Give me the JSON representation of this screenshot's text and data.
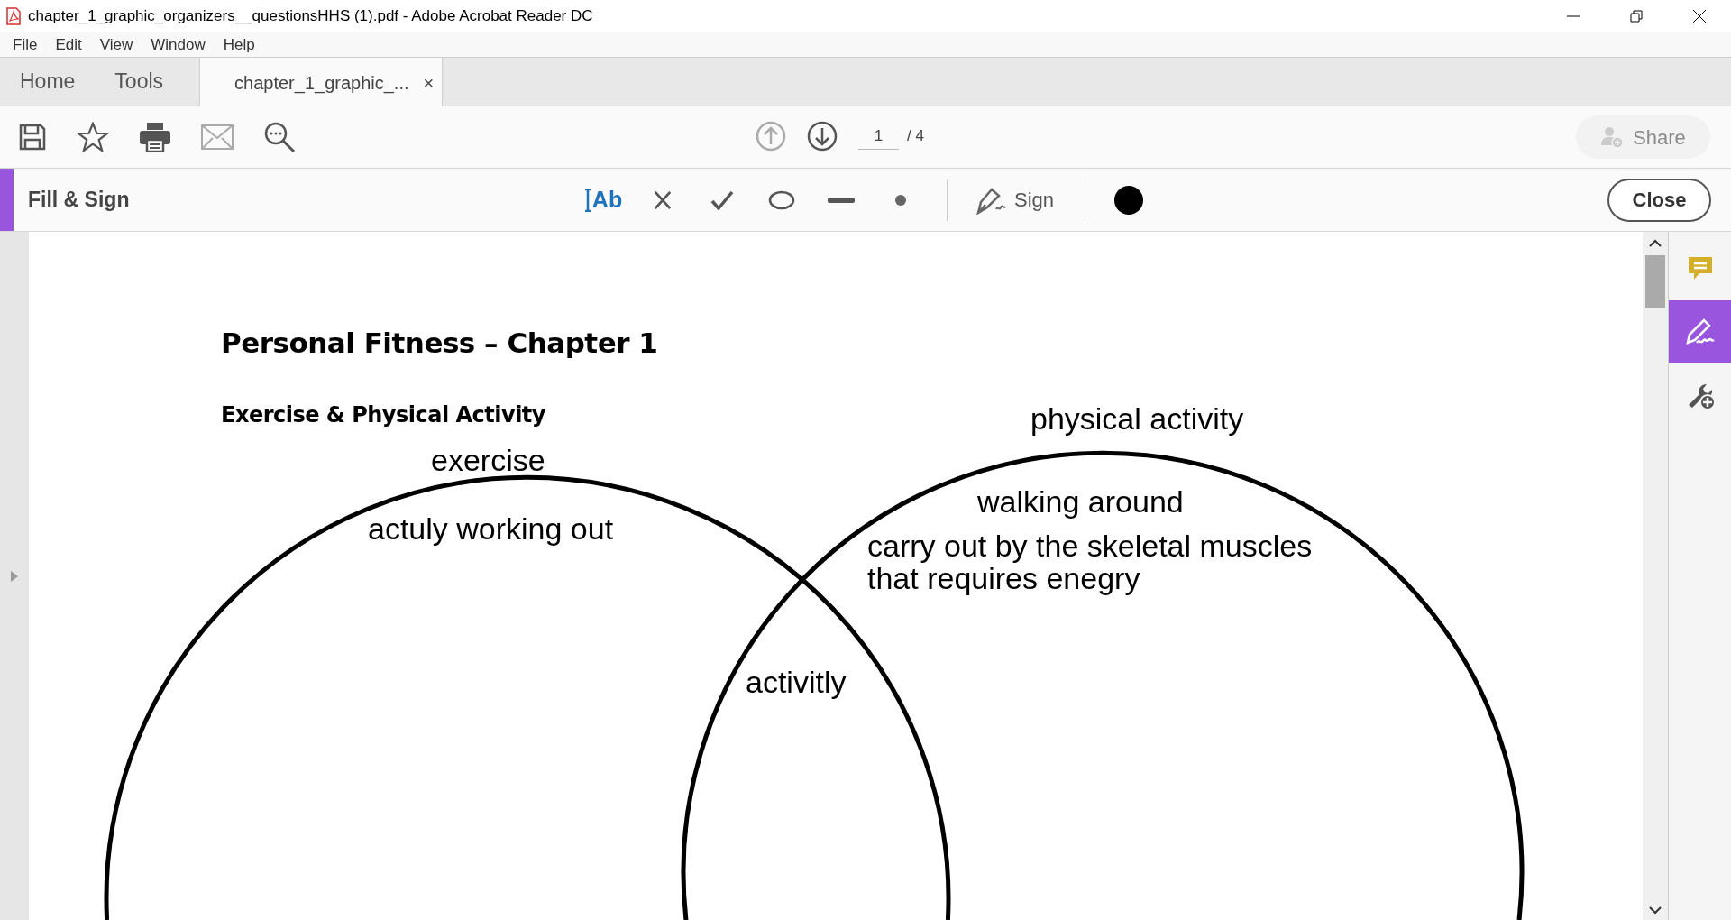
{
  "window": {
    "title": "chapter_1_graphic_organizers__questionsHHS (1).pdf - Adobe Acrobat Reader DC"
  },
  "menu": [
    "File",
    "Edit",
    "View",
    "Window",
    "Help"
  ],
  "tabs": [
    {
      "label": "Home",
      "selected": false,
      "kind": "nav"
    },
    {
      "label": "Tools",
      "selected": false,
      "kind": "nav"
    },
    {
      "label": "chapter_1_graphic_...",
      "selected": true,
      "kind": "doc",
      "close": "×"
    }
  ],
  "toolbar": {
    "page_value": "1",
    "page_total": "/ 4",
    "share": {
      "label": "Share",
      "disabled": true
    }
  },
  "fill_sign": {
    "title": "Fill & Sign",
    "tools": [
      {
        "kind": "text",
        "label": "Ab"
      },
      {
        "kind": "cross"
      },
      {
        "kind": "check"
      },
      {
        "kind": "ellipse"
      },
      {
        "kind": "line"
      },
      {
        "kind": "dot"
      }
    ],
    "sign": "Sign",
    "color": "#000000",
    "close": "Close"
  },
  "document": {
    "heading": "Personal Fitness – Chapter 1",
    "subheading": "Exercise & Physical Activity",
    "annotations": [
      {
        "text": "exercise"
      },
      {
        "text": "actuly working out"
      },
      {
        "text": "physical activity"
      },
      {
        "text": "walking around"
      },
      {
        "text": "carry out by the skeletal muscles\nthat requires enegry"
      },
      {
        "text": "activitly"
      }
    ]
  },
  "right_panel": [
    {
      "kind": "comment",
      "selected": false
    },
    {
      "kind": "fill_sign",
      "selected": true
    },
    {
      "kind": "more_tools",
      "selected": false
    }
  ]
}
